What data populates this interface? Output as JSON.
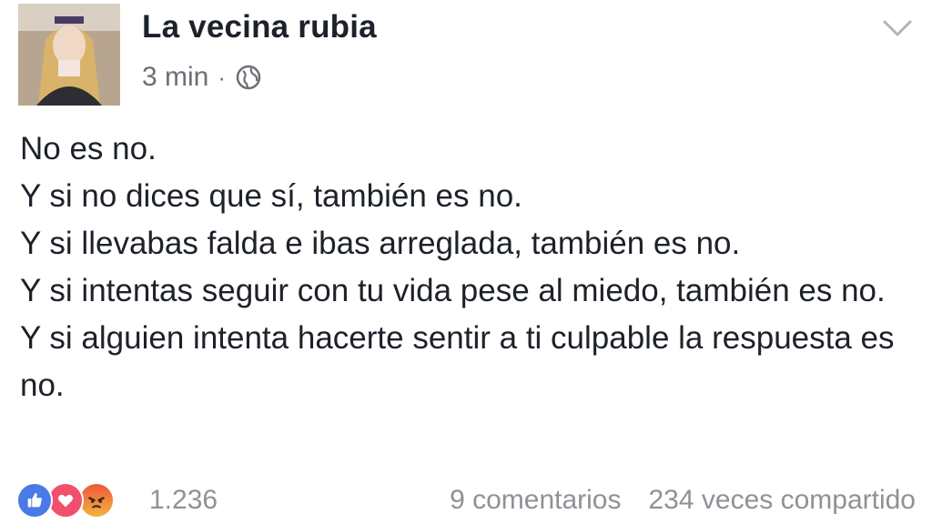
{
  "post": {
    "author": "La vecina rubia",
    "time": "3 min",
    "separator": "·",
    "privacy_icon": "globe-icon",
    "menu_icon": "chevron-down-icon",
    "lines": [
      "No es no.",
      "Y si no dices que sí, también es no.",
      "Y si llevabas falda e ibas arreglada, también es no.",
      "Y si intentas seguir con tu vida pese al miedo, también es no.",
      "Y si alguien intenta hacerte sentir a ti culpable la respuesta es no."
    ]
  },
  "footer": {
    "reaction_icons": [
      "like-icon",
      "love-icon",
      "angry-icon"
    ],
    "reaction_count": "1.236",
    "comments": "9 comentarios",
    "shares": "234 veces compartido"
  },
  "colors": {
    "like": "#4a79e8",
    "love": "#f0506e",
    "angry": "#f0553a",
    "muted_text": "#8e9196"
  }
}
